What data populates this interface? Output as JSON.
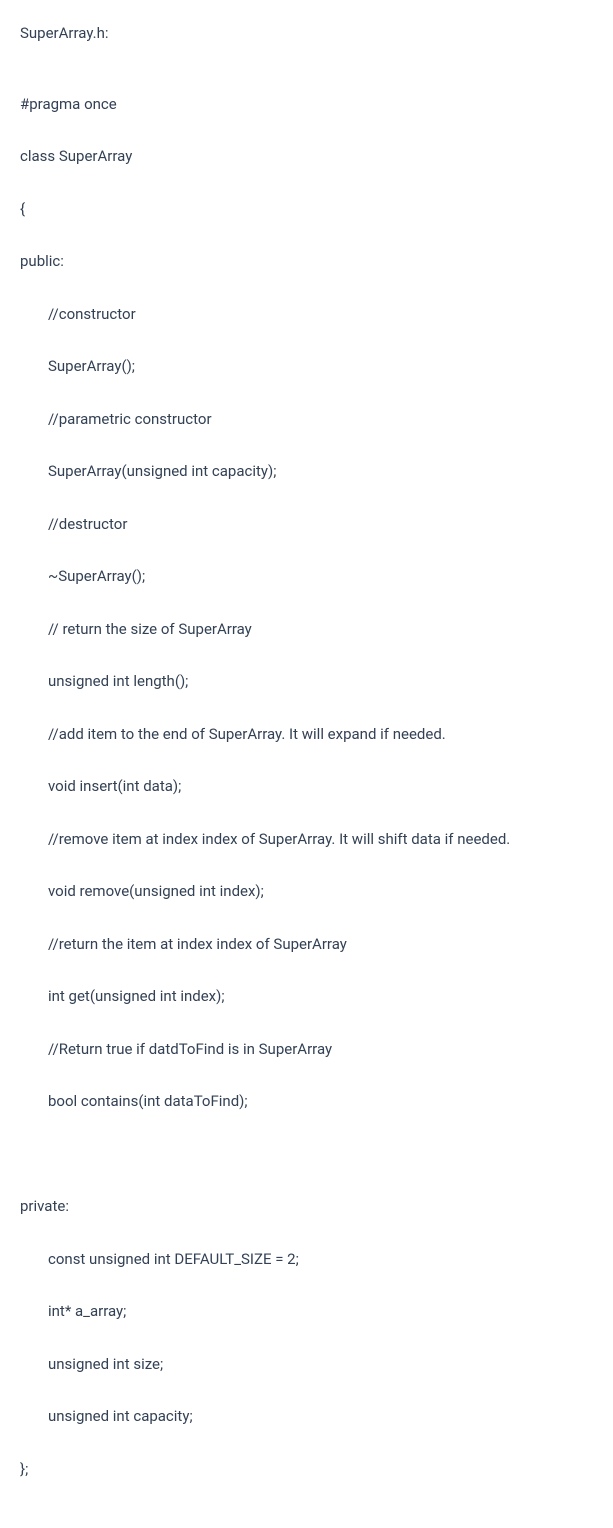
{
  "filename": "SuperArray.h:",
  "lines": {
    "pragma": "#pragma once",
    "class_decl": "class SuperArray",
    "open_brace": "{",
    "public_label": "public:",
    "comment_constructor": "//constructor",
    "constructor": "SuperArray();",
    "comment_param_constructor": "//parametric constructor",
    "param_constructor": "SuperArray(unsigned int capacity);",
    "comment_destructor": "//destructor",
    "destructor": "~SuperArray();",
    "comment_length": "// return the size of SuperArray",
    "length": "unsigned int length();",
    "comment_insert": "//add item to the end of SuperArray. It will expand if needed.",
    "insert": "void insert(int data);",
    "comment_remove": "//remove item at index index of SuperArray. It will shift data if needed.",
    "remove": "void remove(unsigned int index);",
    "comment_get": "//return the item at index index of SuperArray",
    "get": "int get(unsigned int index);",
    "comment_contains": "//Return true if datdToFind is in SuperArray",
    "contains": "bool contains(int dataToFind);",
    "private_label": "private:",
    "default_size": "const unsigned int DEFAULT_SIZE = 2;",
    "array_ptr": "int* a_array;",
    "size_member": "unsigned int size;",
    "capacity_member": "unsigned int capacity;",
    "close_brace": "};"
  }
}
